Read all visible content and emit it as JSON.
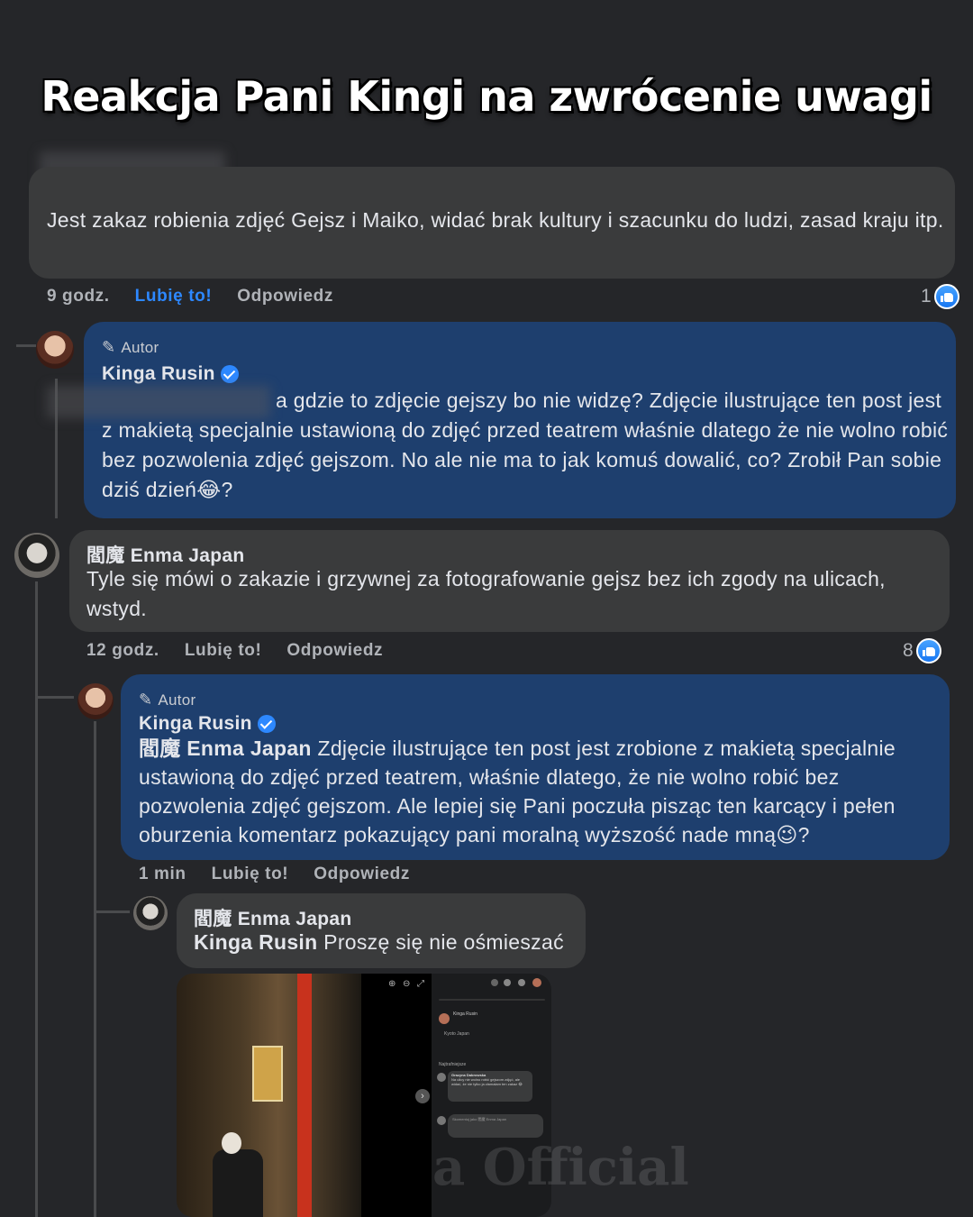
{
  "title": "Reakcja Pani Kingi na zwrócenie uwagi",
  "comment1": {
    "text": "Jest zakaz robienia zdjęć Gejsz i Maiko, widać brak kultury i szacunku do ludzi, zasad kraju itp.",
    "time": "9 godz.",
    "like": "Lubię to!",
    "reply": "Odpowiedz",
    "reactions": "1"
  },
  "reply1": {
    "badge": "Autor",
    "author": "Kinga Rusin",
    "text": "a gdzie to zdjęcie gejszy bo nie widzę? Zdjęcie ilustrujące ten post jest z makietą specjalnie ustawioną do zdjęć przed teatrem właśnie dlatego że nie wolno robić bez pozwolenia zdjęć gejszom. No ale nie ma to jak komuś dowalić, co? Zrobił Pan sobie dziś dzień😂?"
  },
  "comment2": {
    "author": "閻魔 Enma Japan",
    "text": "Tyle się mówi o zakazie i grzywnej za fotografowanie gejsz bez ich zgody na ulicach, wstyd.",
    "time": "12 godz.",
    "like": "Lubię to!",
    "reply": "Odpowiedz",
    "reactions": "8"
  },
  "reply2": {
    "badge": "Autor",
    "author": "Kinga Rusin",
    "mention": "閻魔 Enma Japan",
    "text": " Zdjęcie ilustrujące ten post jest zrobione z makietą specjalnie ustawioną do zdjęć przed teatrem, właśnie dlatego, że nie wolno robić bez pozwolenia zdjęć gejszom. Ale lepiej się Pani poczuła pisząc ten karcący i pełen oburzenia komentarz pokazujący pani moralną wyższość nade mną😉?",
    "time": "1 min",
    "like": "Lubię to!",
    "reply": "Odpowiedz"
  },
  "reply3": {
    "author": "閻魔 Enma Japan",
    "mention": "Kinga Rusin",
    "text": " Proszę się nie ośmieszać"
  },
  "screenshot": {
    "post_author": "Kinga Rusin",
    "location": "Kyoto Japan",
    "filter": "Najtrafniejsze",
    "comment_author": "Grazyna Dabrowska",
    "comment_text": "Na ulicy nie wolno robić gejszom zdjęć, ale widać, że nie tylko ja złamałam ten zakaz 😂",
    "composer": "Skomentuj jako 閻魔 Enma Japan"
  },
  "watermark": "a Official",
  "colors": {
    "background": "#252629",
    "bubble": "#3a3b3c",
    "author_bubble": "#1e3f6e",
    "accent": "#2d88ff"
  }
}
